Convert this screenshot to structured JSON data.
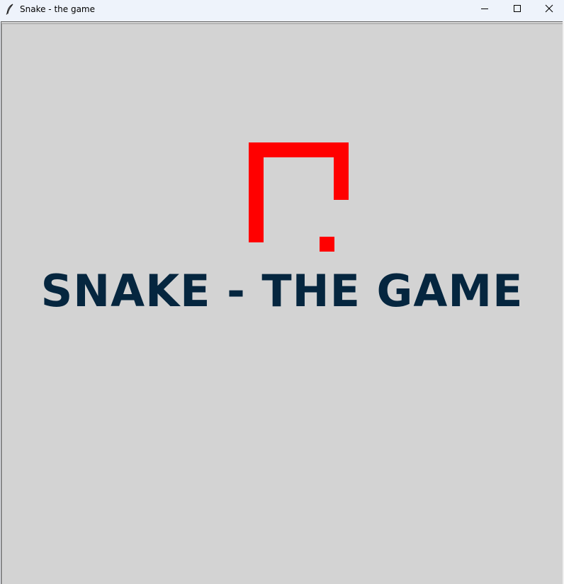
{
  "window": {
    "title": "Snake - the game"
  },
  "titlebar_buttons": {
    "minimize": "minimize-icon",
    "maximize": "maximize-icon",
    "close": "close-icon"
  },
  "game": {
    "title": "SNAKE - THE GAME",
    "title_color": "#05263f",
    "background_color": "#d3d3d3",
    "snake_color": "#ff0000",
    "food_color": "#ff0000"
  }
}
